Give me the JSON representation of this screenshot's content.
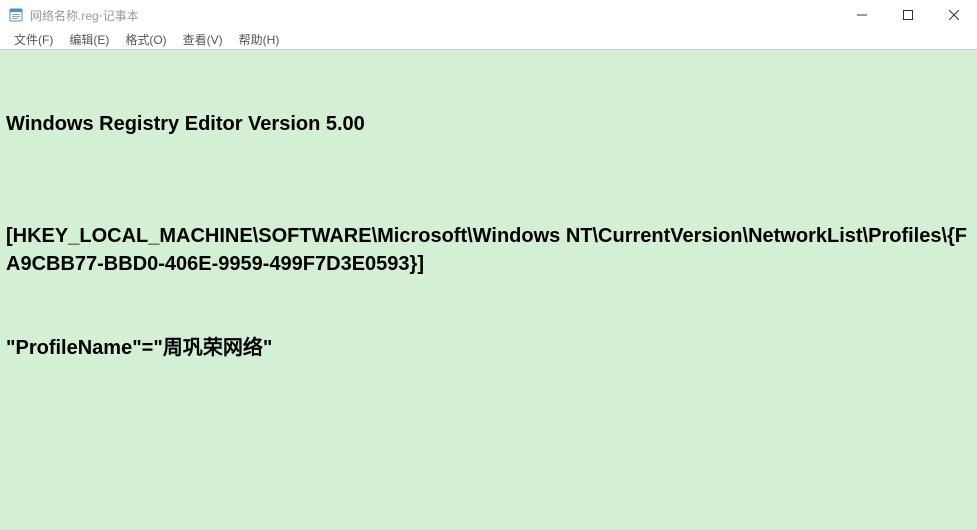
{
  "titlebar": {
    "filename": "网络名称.reg",
    "separator": " - ",
    "appname": "记事本"
  },
  "menubar": {
    "items": [
      "文件(F)",
      "编辑(E)",
      "格式(O)",
      "查看(V)",
      "帮助(H)"
    ]
  },
  "content": {
    "lines": [
      "Windows Registry Editor Version 5.00",
      "",
      "[HKEY_LOCAL_MACHINE\\SOFTWARE\\Microsoft\\Windows NT\\CurrentVersion\\NetworkList\\Profiles\\{FA9CBB77-BBD0-406E-9959-499F7D3E0593}]",
      "\"ProfileName\"=\"周巩荣网络\""
    ]
  }
}
